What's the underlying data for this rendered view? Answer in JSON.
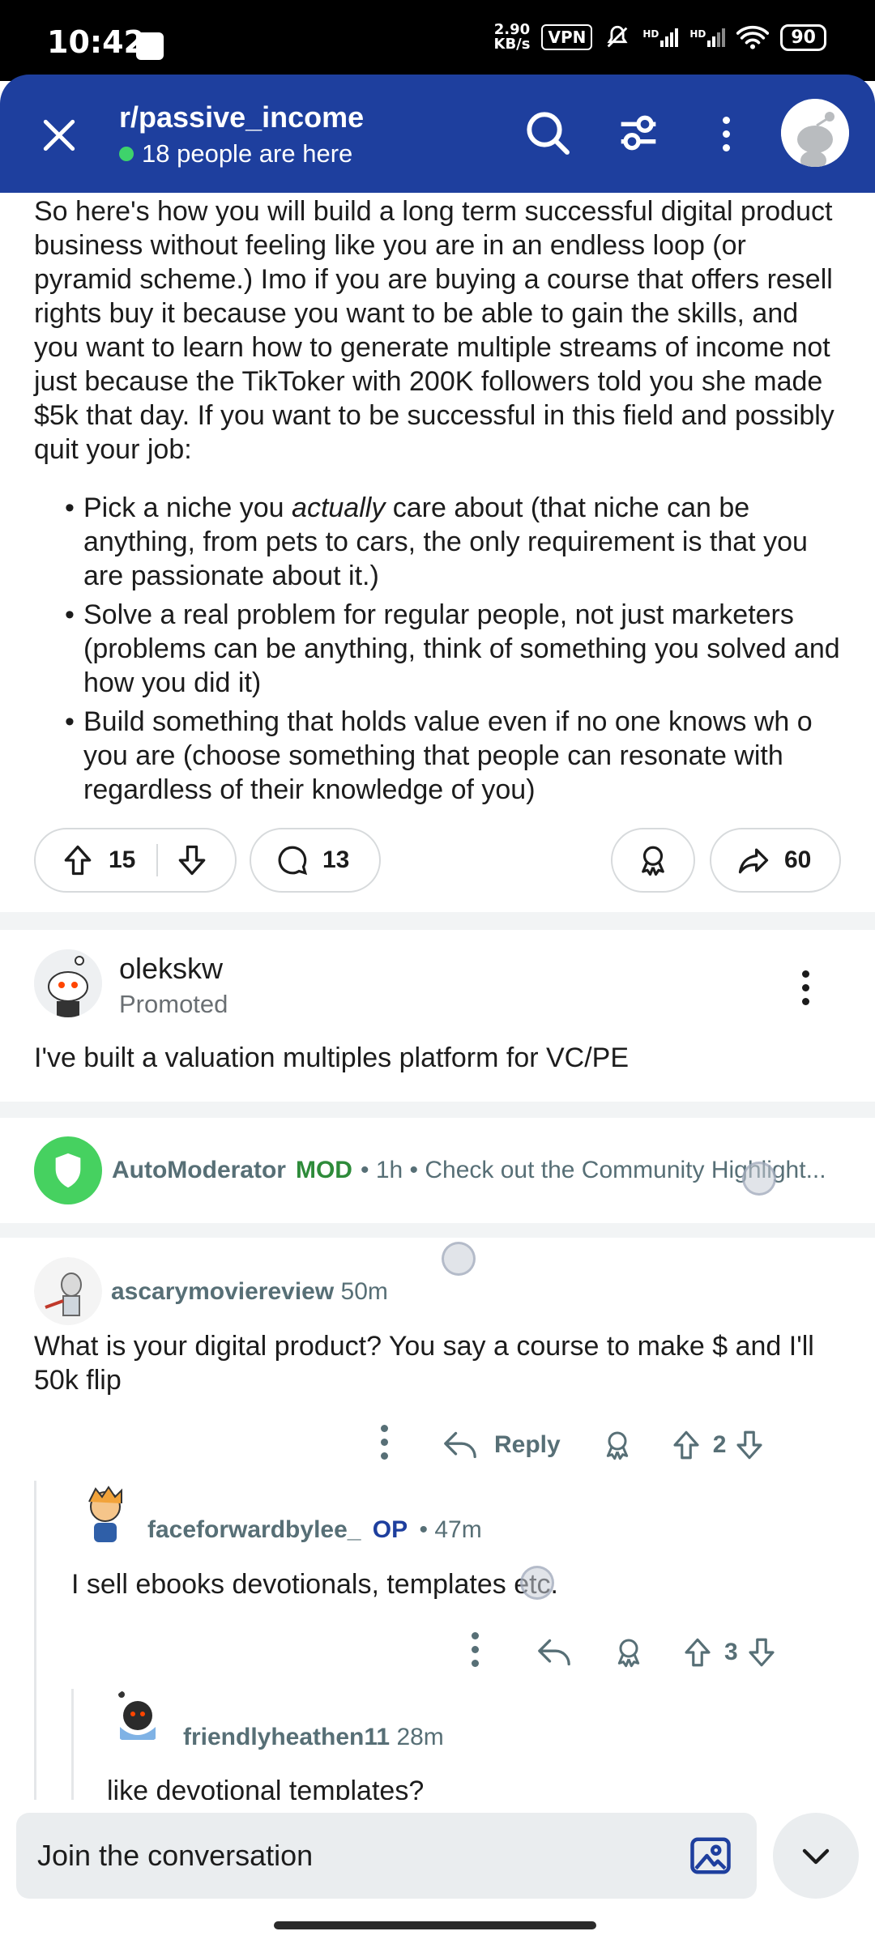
{
  "status_bar": {
    "time": "10:42",
    "net_speed_value": "2.90",
    "net_speed_unit": "KB/s",
    "vpn": "VPN",
    "signal1": "HD",
    "signal2": "HD",
    "battery": "90"
  },
  "header": {
    "subreddit": "r/passive_income",
    "online_text": "18 people are here",
    "colors": {
      "background": "#1e3f9e",
      "online": "#3ed36b"
    }
  },
  "post": {
    "paragraph": "So here's how you will build a long term successful digital product business without feeling like you are in an endless loop (or pyramid scheme.) Imo if you are buying a course that offers resell rights buy it because you want to be able to gain the skills, and you want to learn how to generate multiple streams of income not just because the TikToker with 200K followers told you she made $5k that day. If you want to be successful in this field and possibly quit your job:",
    "bullet1_pre": "Pick a niche you ",
    "bullet1_em": "actually",
    "bullet1_post": " care about (that niche can be anything, from pets to cars, the only requirement is that you are passionate about it.)",
    "bullet2": "Solve a real problem for regular people, not just marketers (problems can be anything, think of something you solved and how you did it)",
    "bullet3": "Build something that holds value even if no one knows wh o you are (choose something that people can resonate with regardless of their knowledge of you)",
    "upvotes": "15",
    "comments": "13",
    "shares": "60"
  },
  "promoted": {
    "username": "olekskw",
    "tag": "Promoted",
    "text": "I've built a valuation multiples platform for VC/PE"
  },
  "automod": {
    "username": "AutoModerator",
    "badge": "MOD",
    "meta": "• 1h • Check out the Community Highlight...",
    "colors": {
      "avatar": "#46d160",
      "badge": "#2e8b3a"
    }
  },
  "comments": [
    {
      "username": "ascarymoviereview",
      "time": "50m",
      "text": "What is your digital product? You say a course to make $ and I'll 50k flip",
      "reply_label": "Reply",
      "score": "2"
    },
    {
      "username": "faceforwardbylee_",
      "badge": "OP",
      "time": "• 47m",
      "text": "I sell ebooks devotionals, templates etc.",
      "score": "3",
      "colors": {
        "badge": "#1e3f9e"
      }
    },
    {
      "username": "friendlyheathen11",
      "time": "28m",
      "text": "like devotional templates?"
    }
  ],
  "composer": {
    "placeholder": "Join the conversation"
  }
}
